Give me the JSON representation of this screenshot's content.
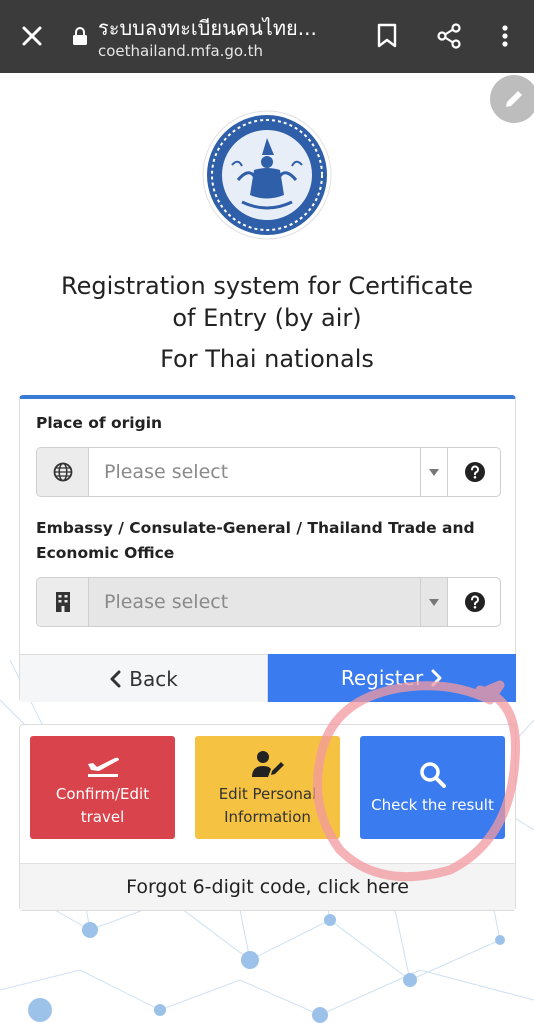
{
  "browser": {
    "title": "ระบบลงทะเบียนคนไทย...",
    "url": "coethailand.mfa.go.th"
  },
  "page": {
    "title_line1": "Registration system for Certificate",
    "title_line2": "of Entry (by air)",
    "subtitle": "For Thai nationals"
  },
  "form": {
    "origin_label": "Place of origin",
    "origin_placeholder": "Please select",
    "embassy_label_line1": "Embassy / Consulate-General / Thailand Trade and",
    "embassy_label_line2": "Economic Office",
    "embassy_placeholder": "Please select",
    "back_label": "Back",
    "register_label": "Register"
  },
  "actions": {
    "confirm_line1": "Confirm/Edit",
    "confirm_line2": "travel",
    "edit_line1": "Edit Personal",
    "edit_line2": "Information",
    "check_label": "Check the result",
    "forgot_label": "Forgot 6-digit code, click here"
  },
  "colors": {
    "topbar": "#3b3b3b",
    "primary_blue": "#3a7bf0",
    "red": "#d9434c",
    "yellow": "#f5c242",
    "annotation_circle": "#f29aa0"
  },
  "icons": {
    "close": "close-icon",
    "lock": "lock-icon",
    "bookmark": "bookmark-icon",
    "share": "share-icon",
    "menu": "more-vert-icon",
    "origin_addon": "globe-icon",
    "embassy_addon": "building-icon",
    "help": "question-circle-icon",
    "confirm": "airplane-departure-icon",
    "edit": "user-edit-icon",
    "check": "search-icon"
  }
}
